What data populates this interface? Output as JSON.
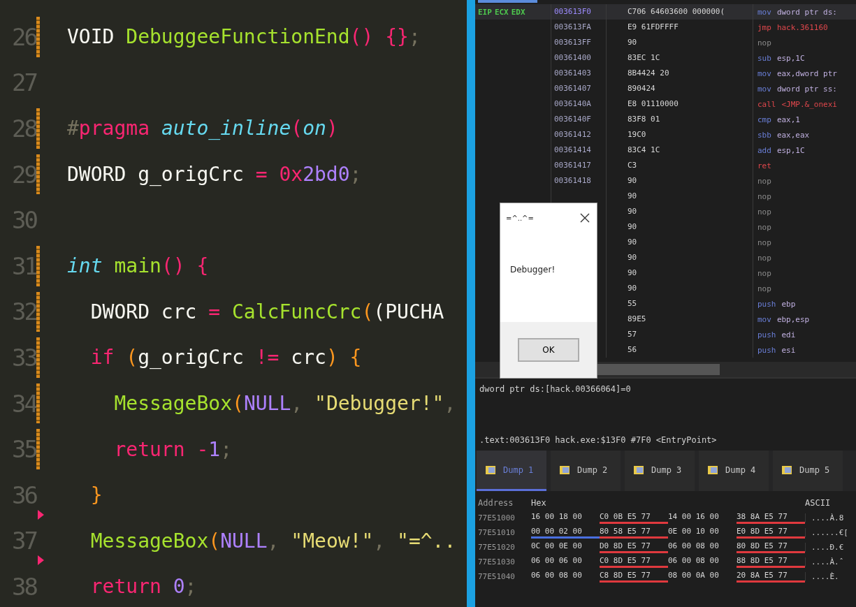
{
  "editor": {
    "lines": [
      {
        "number": "26",
        "modified": true,
        "marker": false,
        "tokens": [
          {
            "text": "VOID ",
            "kind": "plain"
          },
          {
            "text": "DebuggeeFunctionEnd",
            "kind": "func"
          },
          {
            "text": "() {}",
            "kind": "op"
          },
          {
            "text": ";",
            "kind": "dim"
          }
        ]
      },
      {
        "number": "27",
        "modified": false,
        "marker": false
      },
      {
        "number": "28",
        "modified": true,
        "marker": false,
        "tokens": [
          {
            "text": "#",
            "kind": "dim"
          },
          {
            "text": "pragma ",
            "kind": "op"
          },
          {
            "text": "auto_inline",
            "kind": "type"
          },
          {
            "text": "(",
            "kind": "op"
          },
          {
            "text": "on",
            "kind": "type"
          },
          {
            "text": ")",
            "kind": "op"
          }
        ]
      },
      {
        "number": "29",
        "modified": true,
        "marker": false,
        "tokens": [
          {
            "text": "DWORD g_origCrc ",
            "kind": "plain"
          },
          {
            "text": "= 0x",
            "kind": "op"
          },
          {
            "text": "2bd0",
            "kind": "number"
          },
          {
            "text": ";",
            "kind": "dim"
          }
        ]
      },
      {
        "number": "30",
        "modified": false,
        "marker": false
      },
      {
        "number": "31",
        "modified": true,
        "marker": false,
        "tokens": [
          {
            "text": "int ",
            "kind": "type"
          },
          {
            "text": "main",
            "kind": "func"
          },
          {
            "text": "() {",
            "kind": "op"
          }
        ]
      },
      {
        "number": "32",
        "modified": true,
        "marker": false,
        "tokens": [
          {
            "text": "  DWORD crc ",
            "kind": "plain"
          },
          {
            "text": "= ",
            "kind": "op"
          },
          {
            "text": "CalcFuncCrc",
            "kind": "func"
          },
          {
            "text": "(",
            "kind": "paren"
          },
          {
            "text": "(PUCHA",
            "kind": "plain"
          }
        ]
      },
      {
        "number": "33",
        "modified": true,
        "marker": false,
        "tokens": [
          {
            "text": "  if ",
            "kind": "op"
          },
          {
            "text": "(",
            "kind": "paren"
          },
          {
            "text": "g_origCrc ",
            "kind": "plain"
          },
          {
            "text": "!= ",
            "kind": "op"
          },
          {
            "text": "crc",
            "kind": "plain"
          },
          {
            "text": ") {",
            "kind": "paren"
          }
        ]
      },
      {
        "number": "34",
        "modified": true,
        "marker": false,
        "tokens": [
          {
            "text": "    MessageBox",
            "kind": "func"
          },
          {
            "text": "(",
            "kind": "paren"
          },
          {
            "text": "NULL",
            "kind": "number"
          },
          {
            "text": ", ",
            "kind": "dim"
          },
          {
            "text": "\"Debugger!\"",
            "kind": "string"
          },
          {
            "text": ",",
            "kind": "dim"
          }
        ]
      },
      {
        "number": "35",
        "modified": true,
        "marker": false,
        "tokens": [
          {
            "text": "    return ",
            "kind": "op"
          },
          {
            "text": "-",
            "kind": "op"
          },
          {
            "text": "1",
            "kind": "number"
          },
          {
            "text": ";",
            "kind": "dim"
          }
        ]
      },
      {
        "number": "36",
        "modified": false,
        "marker": false,
        "tokens": [
          {
            "text": "  }",
            "kind": "paren"
          }
        ]
      },
      {
        "number": "37",
        "modified": false,
        "marker": true,
        "tokens": [
          {
            "text": "  MessageBox",
            "kind": "func"
          },
          {
            "text": "(",
            "kind": "paren"
          },
          {
            "text": "NULL",
            "kind": "number"
          },
          {
            "text": ", ",
            "kind": "dim"
          },
          {
            "text": "\"Meow!\"",
            "kind": "string"
          },
          {
            "text": ", ",
            "kind": "dim"
          },
          {
            "text": "\"=^..",
            "kind": "string"
          }
        ]
      },
      {
        "number": "38",
        "modified": false,
        "marker": true,
        "tokens": [
          {
            "text": "  return ",
            "kind": "op"
          },
          {
            "text": "0",
            "kind": "number"
          },
          {
            "text": ";",
            "kind": "dim"
          }
        ]
      }
    ]
  },
  "debugger": {
    "register_labels": [
      "EIP",
      "ECX",
      "EDX"
    ],
    "disassembly": [
      {
        "address": "003613F0",
        "bytes": "C706 64603600 000000(",
        "mnemonic": "mov",
        "operands": "dword ptr ds:",
        "kind": "data",
        "selected": true
      },
      {
        "address": "003613FA",
        "bytes": "E9 61FDFFFF",
        "mnemonic": "jmp",
        "operands": "hack.361160",
        "kind": "branch",
        "selected": false
      },
      {
        "address": "003613FF",
        "bytes": "90",
        "mnemonic": "nop",
        "kind": "nop",
        "selected": false
      },
      {
        "address": "00361400",
        "bytes": "83EC 1C",
        "mnemonic": "sub",
        "operands": "esp,1C",
        "kind": "data",
        "selected": false
      },
      {
        "address": "00361403",
        "bytes": "8B4424 20",
        "mnemonic": "mov",
        "operands": "eax,dword ptr",
        "kind": "data",
        "selected": false
      },
      {
        "address": "00361407",
        "bytes": "890424",
        "mnemonic": "mov",
        "operands": "dword ptr ss:",
        "kind": "data",
        "selected": false
      },
      {
        "address": "0036140A",
        "bytes": "E8 01110000",
        "mnemonic": "call",
        "operands": "<JMP.&_onexi",
        "kind": "branch",
        "selected": false
      },
      {
        "address": "0036140F",
        "bytes": "83F8 01",
        "mnemonic": "cmp",
        "operands": "eax,1",
        "kind": "data",
        "selected": false
      },
      {
        "address": "00361412",
        "bytes": "19C0",
        "mnemonic": "sbb",
        "operands": "eax,eax",
        "kind": "data",
        "selected": false
      },
      {
        "address": "00361414",
        "bytes": "83C4 1C",
        "mnemonic": "add",
        "operands": "esp,1C",
        "kind": "data",
        "selected": false
      },
      {
        "address": "00361417",
        "bytes": "C3",
        "mnemonic": "ret",
        "kind": "branch",
        "selected": false
      },
      {
        "address": "00361418",
        "bytes": "90",
        "mnemonic": "nop",
        "kind": "nop",
        "selected": false
      },
      {
        "bytes": "90",
        "mnemonic": "nop",
        "kind": "nop",
        "selected": false
      },
      {
        "bytes": "90",
        "mnemonic": "nop",
        "kind": "nop",
        "selected": false
      },
      {
        "bytes": "90",
        "mnemonic": "nop",
        "kind": "nop",
        "selected": false
      },
      {
        "bytes": "90",
        "mnemonic": "nop",
        "kind": "nop",
        "selected": false
      },
      {
        "bytes": "90",
        "mnemonic": "nop",
        "kind": "nop",
        "selected": false
      },
      {
        "bytes": "90",
        "mnemonic": "nop",
        "kind": "nop",
        "selected": false
      },
      {
        "bytes": "90",
        "mnemonic": "nop",
        "kind": "nop",
        "selected": false
      },
      {
        "bytes": "55",
        "mnemonic": "push",
        "operands": "ebp",
        "kind": "data",
        "selected": false
      },
      {
        "bytes": "89E5",
        "mnemonic": "mov",
        "operands": "ebp,esp",
        "kind": "data",
        "selected": false
      },
      {
        "bytes": "57",
        "mnemonic": "push",
        "operands": "edi",
        "kind": "data",
        "selected": false
      },
      {
        "bytes": "56",
        "mnemonic": "push",
        "operands": "esi",
        "kind": "data",
        "selected": false
      }
    ],
    "dialog": {
      "title": "=^..^=",
      "message": "Debugger!",
      "button": "OK"
    },
    "expression": "dword ptr ds:[hack.00366064]=0",
    "location": ".text:003613F0 hack.exe:$13F0 #7F0 <EntryPoint>",
    "dump_tabs": [
      {
        "label": "Dump 1",
        "selected": true
      },
      {
        "label": "Dump 2",
        "selected": false
      },
      {
        "label": "Dump 3",
        "selected": false
      },
      {
        "label": "Dump 4",
        "selected": false
      },
      {
        "label": "Dump 5",
        "selected": false
      }
    ],
    "hex_columns": {
      "address": "Address",
      "hex": "Hex",
      "ascii": "ASCII"
    },
    "hex_rows": [
      {
        "address": "77E51000",
        "groups": [
          {
            "bytes": "16 00 18 00",
            "kind": "plain"
          },
          {
            "bytes": "C0 0B E5 77",
            "kind": "pointer"
          },
          {
            "bytes": "14 00 16 00",
            "kind": "plain"
          },
          {
            "bytes": "38 8A E5 77",
            "kind": "pointer"
          }
        ],
        "ascii": "....À.8"
      },
      {
        "address": "77E51010",
        "groups": [
          {
            "bytes": "00 00 02 00",
            "kind": "selected"
          },
          {
            "bytes": "80 58 E5 77",
            "kind": "pointer"
          },
          {
            "bytes": "0E 00 10 00",
            "kind": "plain"
          },
          {
            "bytes": "E0 8D E5 77",
            "kind": "pointer"
          }
        ],
        "ascii": "......€["
      },
      {
        "address": "77E51020",
        "groups": [
          {
            "bytes": "0C 00 0E 00",
            "kind": "plain"
          },
          {
            "bytes": "D0 8D E5 77",
            "kind": "pointer"
          },
          {
            "bytes": "06 00 08 00",
            "kind": "plain"
          },
          {
            "bytes": "80 8D E5 77",
            "kind": "pointer"
          }
        ],
        "ascii": "....Ð.€"
      },
      {
        "address": "77E51030",
        "groups": [
          {
            "bytes": "06 00 06 00",
            "kind": "plain"
          },
          {
            "bytes": "C0 8D E5 77",
            "kind": "pointer"
          },
          {
            "bytes": "06 00 08 00",
            "kind": "plain"
          },
          {
            "bytes": "88 8D E5 77",
            "kind": "pointer"
          }
        ],
        "ascii": "....À.ˆ"
      },
      {
        "address": "77E51040",
        "groups": [
          {
            "bytes": "06 00 08 00",
            "kind": "plain"
          },
          {
            "bytes": "C8 8D E5 77",
            "kind": "pointer"
          },
          {
            "bytes": "08 00 0A 00",
            "kind": "plain"
          },
          {
            "bytes": "20 8A E5 77",
            "kind": "pointer"
          }
        ],
        "ascii": "....È. "
      }
    ]
  }
}
